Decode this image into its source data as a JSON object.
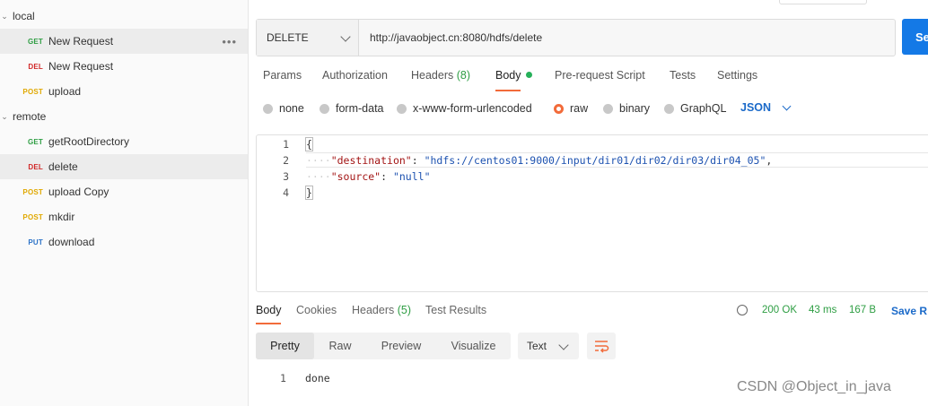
{
  "sidebar": {
    "folders": [
      {
        "label": "local"
      },
      {
        "label": "remote"
      }
    ],
    "requests": [
      {
        "method": "GET",
        "label": "New Request"
      },
      {
        "method": "DEL",
        "label": "New Request"
      },
      {
        "method": "POST",
        "label": "upload"
      },
      {
        "method": "GET",
        "label": "getRootDirectory"
      },
      {
        "method": "DEL",
        "label": "delete"
      },
      {
        "method": "POST",
        "label": "upload Copy"
      },
      {
        "method": "POST",
        "label": "mkdir"
      },
      {
        "method": "PUT",
        "label": "download"
      }
    ],
    "more_icon": "•••"
  },
  "request": {
    "method": "DELETE",
    "url": "http://javaobject.cn:8080/hdfs/delete",
    "send_label": "Se"
  },
  "tabs": {
    "params": "Params",
    "authorization": "Authorization",
    "headers": "Headers",
    "headers_count": "(8)",
    "body": "Body",
    "prerequest": "Pre-request Script",
    "tests": "Tests",
    "settings": "Settings"
  },
  "body_types": {
    "none": "none",
    "form_data": "form-data",
    "urlencoded": "x-www-form-urlencoded",
    "raw": "raw",
    "binary": "binary",
    "graphql": "GraphQL",
    "selected": "raw",
    "format": "JSON"
  },
  "editor": {
    "line_numbers": [
      "1",
      "2",
      "3",
      "4"
    ],
    "open_brace": "{",
    "close_brace": "}",
    "key1": "\"destination\"",
    "val1": "\"hdfs://centos01:9000/input/dir01/dir02/dir03/dir04_05\"",
    "key2": "\"source\"",
    "val2": "\"null\""
  },
  "response": {
    "tabs": {
      "body": "Body",
      "cookies": "Cookies",
      "headers": "Headers",
      "headers_count": "(5)",
      "test_results": "Test Results"
    },
    "status": "200 OK",
    "time": "43 ms",
    "size": "167 B",
    "save_label": "Save R",
    "views": [
      "Pretty",
      "Raw",
      "Preview",
      "Visualize"
    ],
    "text_format": "Text",
    "line_number": "1",
    "body": "done"
  },
  "watermark": "CSDN @Object_in_java",
  "colors": {
    "accent": "#f26b3a",
    "send": "#1479e6",
    "get": "#2e9e43",
    "delete": "#d12828",
    "post": "#e0a800",
    "put": "#2b72c7"
  }
}
